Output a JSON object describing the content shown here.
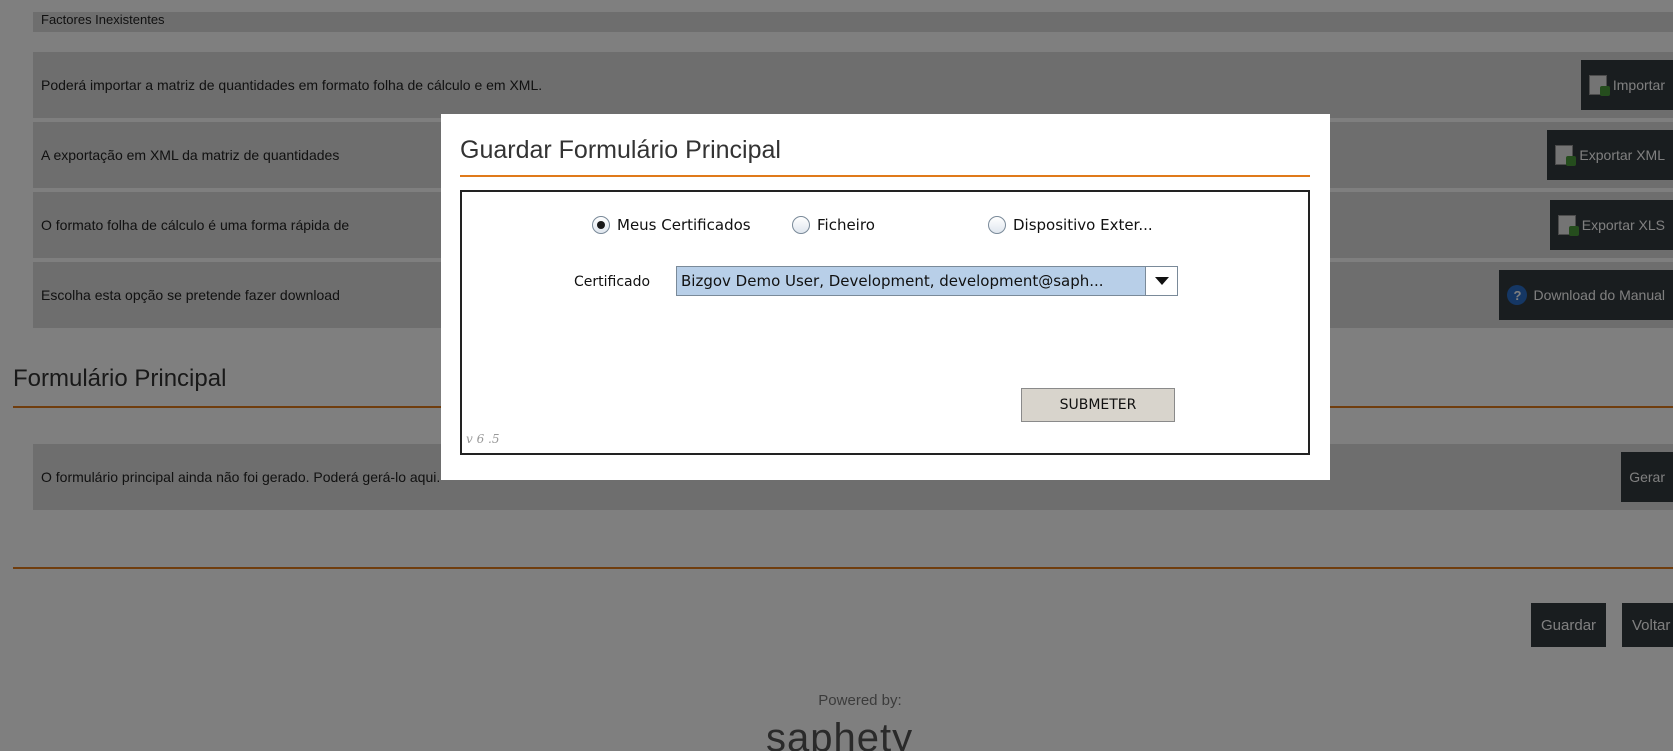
{
  "page": {
    "top_row_text": "Factores Inexistentes",
    "rows": [
      {
        "text": "Poderá importar a matriz de quantidades em formato folha de cálculo e em XML.",
        "button": "Importar",
        "icon": "import-icon"
      },
      {
        "text": "A exportação em XML da matriz de quantidades",
        "button": "Exportar XML",
        "icon": "export-xml-icon"
      },
      {
        "text": "O formato folha de cálculo é uma forma rápida de",
        "button": "Exportar XLS",
        "icon": "export-xls-icon"
      },
      {
        "text": "Escolha esta opção se pretende fazer download",
        "button": "Download do Manual",
        "icon": "help-icon"
      }
    ],
    "section_title": "Formulário Principal",
    "form_row": {
      "text": "O formulário principal ainda não foi gerado. Poderá gerá-lo aqui.",
      "button": "Gerar"
    },
    "save_button": "Guardar",
    "back_button": "Voltar",
    "footer_powered": "Powered by:",
    "footer_logo": "saphety"
  },
  "modal": {
    "title": "Guardar Formulário Principal",
    "radios": [
      {
        "label": "Meus Certificados",
        "checked": true
      },
      {
        "label": "Ficheiro",
        "checked": false
      },
      {
        "label": "Dispositivo Exter...",
        "checked": false
      }
    ],
    "cert_label": "Certificado",
    "cert_value": "Bizgov Demo User, Development, development@saph...",
    "submit_label": "SUBMETER",
    "version": "v 6 .5"
  },
  "colors": {
    "accent": "#e07a1a",
    "dark_button": "#333a3e",
    "row_bg": "#dcdcdc"
  }
}
